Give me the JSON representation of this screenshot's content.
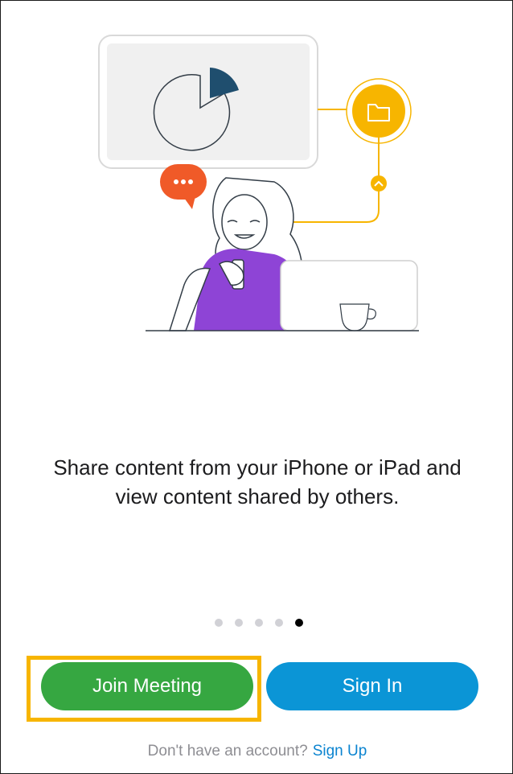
{
  "onboarding": {
    "caption": "Share content from your iPhone or iPad and view content shared by others.",
    "pager": {
      "count": 5,
      "active_index": 4
    }
  },
  "actions": {
    "join_meeting_label": "Join Meeting",
    "sign_in_label": "Sign In"
  },
  "footer": {
    "prompt": "Don't have an account?",
    "sign_up_label": "Sign Up"
  },
  "colors": {
    "join_button": "#36a741",
    "sign_in_button": "#0b95d6",
    "link": "#0b84d0",
    "highlight": "#f7b500",
    "chat_bubble": "#f05a28",
    "folder_badge": "#f7b500",
    "shirt": "#8e44d6",
    "pie_slice": "#1f4e6e"
  },
  "icons": [
    "pie-chart-icon",
    "folder-icon",
    "chevron-up-icon",
    "chat-bubble-icon",
    "coffee-cup-icon"
  ]
}
